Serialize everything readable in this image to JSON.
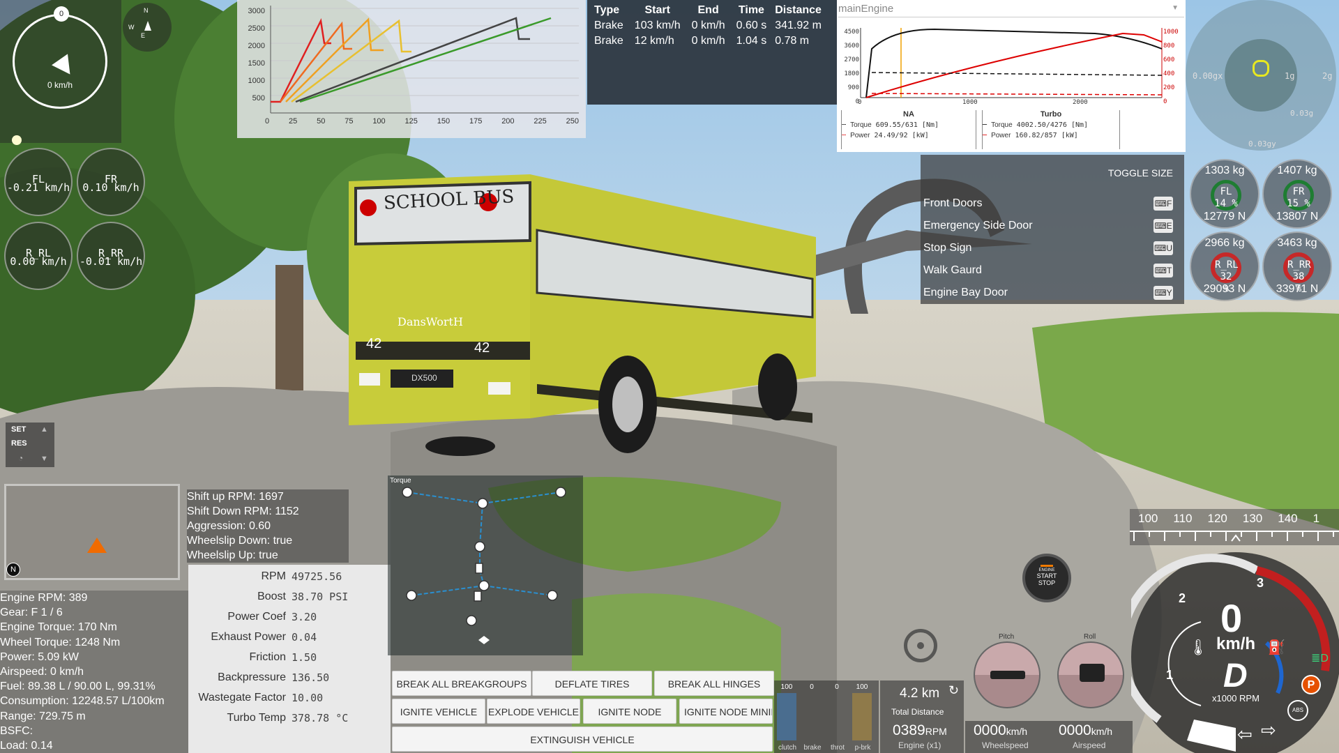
{
  "colors": {
    "sky": "#8fb8d8",
    "bus": "#c8cc3a",
    "grass": "#6f9c3a",
    "rock": "#9a9a96",
    "accent_red": "#d32f2f",
    "accent_blue": "#1976d2",
    "orange": "#f57c00"
  },
  "compass": {
    "speed_label": "0 km/h",
    "heading": "0",
    "dir_n": "N",
    "dir_w": "W",
    "dir_e": "E"
  },
  "wheel_speeds": [
    {
      "name": "FL",
      "value": "-0.21 km/h"
    },
    {
      "name": "FR",
      "value": "0.10 km/h"
    },
    {
      "name": "R_RL",
      "value": "0.00 km/h"
    },
    {
      "name": "R_RR",
      "value": "-0.01 km/h"
    }
  ],
  "gear_chart": {
    "x_ticks": [
      "0",
      "25",
      "50",
      "75",
      "100",
      "125",
      "150",
      "175",
      "200",
      "225",
      "250"
    ],
    "y_ticks": [
      "3000",
      "2500",
      "2000",
      "1500",
      "1000",
      "500"
    ]
  },
  "brake_table": {
    "headers": [
      "Type",
      "Start",
      "End",
      "Time",
      "Distance"
    ],
    "rows": [
      [
        "Brake",
        "103 km/h",
        "0 km/h",
        "0.60 s",
        "341.92 m"
      ],
      [
        "Brake",
        "12 km/h",
        "0 km/h",
        "1.04 s",
        "0.78 m"
      ]
    ]
  },
  "engine_graph": {
    "title": "mainEngine",
    "y_left": [
      "4500",
      "3600",
      "2700",
      "1800",
      "900",
      "0"
    ],
    "y_right": [
      "1000",
      "800",
      "600",
      "400",
      "200",
      "0"
    ],
    "x_ticks": [
      "0",
      "1000",
      "2000"
    ],
    "na": {
      "heading": "NA",
      "torque_label": "Torque",
      "torque_val": "609.55/631",
      "torque_unit": "[Nm]",
      "power_label": "Power",
      "power_val": "24.49/92",
      "power_unit": "[kW]"
    },
    "turbo": {
      "heading": "Turbo",
      "torque_label": "Torque",
      "torque_val": "4002.50/4276",
      "torque_unit": "[Nm]",
      "power_label": "Power",
      "power_val": "160.82/857",
      "power_unit": "[kW]"
    }
  },
  "gforce": {
    "label_x": "0.00gx",
    "label_1g": "1g",
    "label_2g": "2g",
    "label_y_low": "0.03g",
    "label_y": "0.03gy"
  },
  "tires": [
    {
      "kg": "1303 kg",
      "name": "FL",
      "pct": "14 %",
      "n": "12779 N",
      "ring": "#1e7d32"
    },
    {
      "kg": "1407 kg",
      "name": "FR",
      "pct": "15 %",
      "n": "13807 N",
      "ring": "#1e7d32"
    },
    {
      "kg": "2966 kg",
      "name": "R_RL",
      "pct": "32 %",
      "n": "29093 N",
      "ring": "#c62828"
    },
    {
      "kg": "3463 kg",
      "name": "R_RR",
      "pct": "38 %",
      "n": "33971 N",
      "ring": "#c62828"
    }
  ],
  "toggle_panel": {
    "header": "TOGGLE SIZE",
    "items": [
      {
        "label": "Front Doors",
        "key": "F"
      },
      {
        "label": "Emergency Side Door",
        "key": "E"
      },
      {
        "label": "Stop Sign",
        "key": "U"
      },
      {
        "label": "Walk Gaurd",
        "key": "T"
      },
      {
        "label": "Engine Bay Door",
        "key": "Y"
      }
    ]
  },
  "cruise": {
    "set": "SET",
    "res": "RES"
  },
  "minimap": {
    "north": "N"
  },
  "shift_info": [
    "Shift up RPM: 1697",
    "Shift Down RPM: 1152",
    "Aggression: 0.60",
    "Wheelslip Down: true",
    "Wheelslip Up: true"
  ],
  "engine_stats": [
    "Engine RPM: 389",
    "Gear: F 1 / 6",
    "Engine Torque: 170 Nm",
    "Wheel Torque: 1248 Nm",
    "Power: 5.09 kW",
    "Airspeed: 0 km/h",
    "Fuel: 89.38 L / 90.00 L, 99.31%",
    "Consumption: 12248.57 L/100km",
    "Range: 729.75 m",
    "BSFC:",
    "Load: 0.14"
  ],
  "turbo_props": [
    {
      "k": "RPM",
      "v": "49725.56"
    },
    {
      "k": "Boost",
      "v": "38.70 PSI"
    },
    {
      "k": "Power Coef",
      "v": "3.20"
    },
    {
      "k": "Exhaust Power",
      "v": "0.04"
    },
    {
      "k": "Friction",
      "v": "1.50"
    },
    {
      "k": "Backpressure",
      "v": "136.50"
    },
    {
      "k": "Wastegate Factor",
      "v": "10.00"
    },
    {
      "k": "Turbo Temp",
      "v": "378.78 °C"
    }
  ],
  "torque_tree": {
    "title": "Torque"
  },
  "actions": {
    "row1": [
      "BREAK ALL BREAKGROUPS",
      "DEFLATE TIRES",
      "BREAK ALL HINGES"
    ],
    "row2": [
      "IGNITE VEHICLE",
      "EXPLODE VEHICLE",
      "IGNITE NODE",
      "IGNITE NODE MINIM"
    ],
    "row3": "EXTINGUISH VEHICLE"
  },
  "pedals": [
    {
      "label": "clutch",
      "value": "100",
      "level": 1.0
    },
    {
      "label": "brake",
      "value": "0",
      "level": 0
    },
    {
      "label": "throt",
      "value": "0",
      "level": 0
    },
    {
      "label": "p-brk",
      "value": "100",
      "level": 1.0
    }
  ],
  "odometer": {
    "distance": "4.2 km",
    "distance_label": "Total Distance"
  },
  "readouts": [
    {
      "value": "0389",
      "unit": "RPM",
      "label": "Engine (x1)"
    },
    {
      "value": "0000",
      "unit": "km/h",
      "label": "Wheelspeed"
    },
    {
      "value": "0000",
      "unit": "km/h",
      "label": "Airspeed"
    }
  ],
  "attitude": {
    "pitch_label": "Pitch",
    "roll_label": "Roll"
  },
  "start_stop": {
    "line1": "ENGINE",
    "line2": "START",
    "line3": "STOP"
  },
  "speed_tape": {
    "ticks": [
      "100",
      "110",
      "120",
      "130",
      "140",
      "1"
    ]
  },
  "speedo": {
    "speed": "0",
    "unit": "km/h",
    "gear": "D",
    "rpm_unit": "x1000 RPM",
    "marks": [
      "1",
      "2",
      "3"
    ],
    "abs": "ABS",
    "park": "P"
  },
  "bus": {
    "sign": "SCHOOL BUS",
    "brand": "DansWortH",
    "number": "42",
    "plate": "DX500"
  }
}
